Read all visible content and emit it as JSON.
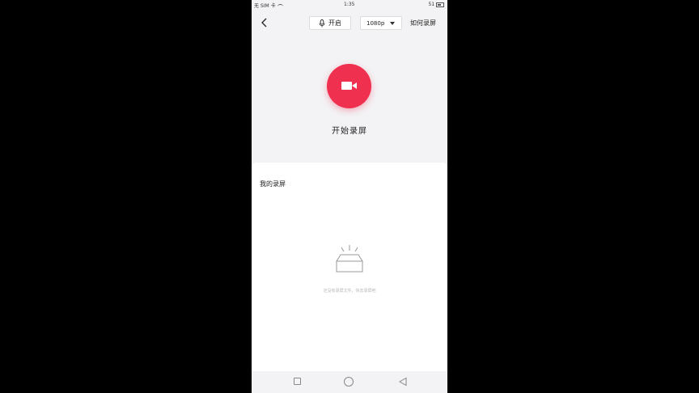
{
  "status_bar": {
    "left_text": "无 SIM 卡",
    "time": "1:35",
    "battery_text": "51"
  },
  "header": {
    "mic_label": "开启",
    "resolution_value": "1080p",
    "how_to_label": "如何录屏"
  },
  "record": {
    "label": "开始录屏"
  },
  "recordings": {
    "title": "我的录屏",
    "empty_text": "还没有录屏文件，快去录屏吧"
  },
  "icons": {
    "back": "chevron-left-icon",
    "mic": "microphone-icon",
    "record": "video-camera-icon",
    "empty": "empty-box-icon"
  },
  "colors": {
    "accent": "#f0304f",
    "background": "#f3f2f4",
    "panel": "#ffffff",
    "muted_text": "#b8b8b8"
  }
}
